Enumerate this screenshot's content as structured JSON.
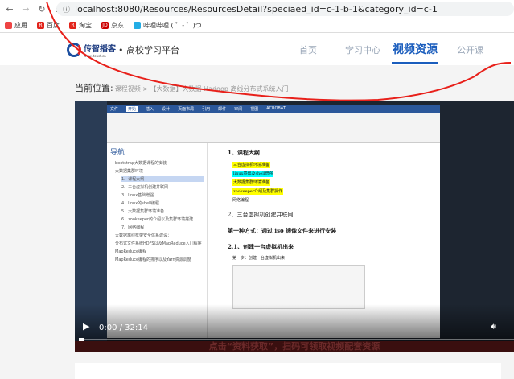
{
  "browser": {
    "url": "localhost:8080/Resources/ResourcesDetail?speciaed_id=c-1-b-1&category_id=c-1",
    "bookmarks": [
      {
        "label": "应用",
        "color": "#e44"
      },
      {
        "label": "百度",
        "color": "#e2231a"
      },
      {
        "label": "淘宝",
        "color": "#e2231a"
      },
      {
        "label": "京东",
        "color": "#c00"
      },
      {
        "label": "哔哩哔哩 ( ゜- ゜)つ...",
        "color": "#23ade5"
      }
    ]
  },
  "header": {
    "brand": "传智播客",
    "site_url": "www.itcast.cn",
    "platform": "• 高校学习平台",
    "nav": [
      "首页",
      "学习中心",
      "视频资源",
      "公开课"
    ],
    "active_nav": "视频资源"
  },
  "breadcrumb": {
    "label": "当前位置:",
    "path": "课程视频 > 【大数据】大数据 Hadoop 离线分布式系统入门"
  },
  "video": {
    "time": "0:00 / 32:14",
    "progress": 0,
    "banner": "点击“资料获取”，扫码可领取视频配套资源",
    "word": {
      "tabs": [
        "文件",
        "开始",
        "插入",
        "设计",
        "页面布局",
        "引用",
        "邮件",
        "审阅",
        "视图",
        "ACROBAT"
      ],
      "nav_title": "导航",
      "nav_items": [
        "bootstrap大数据课程的安装",
        "大数据集群环境",
        "1、课程大纲",
        "2、三台虚拟机创建并联网",
        "3、linux基础增强",
        "4、linux的shell编程",
        "5、大数据集群环境准备",
        "6、zookeeper的介绍以及集群环境搭建",
        "7、网络编程",
        "大数据离线框架安全体系建设：",
        "分布式文件系统HDFS以及MapReduce入门程序",
        "MapReduce编程",
        "MapReduce编程的排序以及Yarn资源调度"
      ],
      "doc": {
        "h1": "1、课程大纲",
        "items": [
          "三台虚拟机环境准备",
          "linux基础及shell增强",
          "大数据集群环境准备",
          "zookeeper介绍及集群操作",
          "网络编程"
        ],
        "h2": "2、三台虚拟机创建并联网",
        "h3": "第一种方式：通过 iso 镜像文件来进行安装",
        "h4": "2.1、创建一台虚拟机出来",
        "step": "第一步：创建一台虚拟机出来"
      }
    }
  }
}
